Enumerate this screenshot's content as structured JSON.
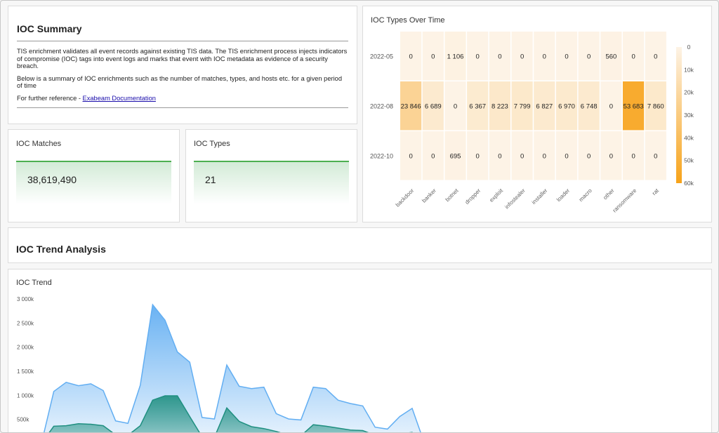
{
  "summary": {
    "title": "IOC Summary",
    "p1": "TIS enrichment validates all event records against existing TIS data. The TIS enrichment process injects indicators of compromise (IOC) tags into event logs and marks that event with IOC metadata as evidence of a security breach.",
    "p2": "Below is a summary of IOC enrichments such as the number of matches, types, and hosts etc. for a given period of time",
    "p3_prefix": "For further reference - ",
    "link_text": "Exabeam Documentation"
  },
  "matches": {
    "title": "IOC Matches",
    "value": "38,619,490"
  },
  "types": {
    "title": "IOC Types",
    "value": "21"
  },
  "trend_section": {
    "title": "IOC Trend Analysis"
  },
  "colors": {
    "heat_low": "#fdf3e6",
    "heat_high": "#f7a319",
    "trend_blue": "#62aef2",
    "trend_teal": "#1f8f80",
    "stat_accent": "#4caf50"
  },
  "chart_data": [
    {
      "type": "heatmap",
      "title": "IOC Types Over Time",
      "x": [
        "backdoor",
        "banker",
        "botnet",
        "dropper",
        "exploit",
        "infostealer",
        "installer",
        "loader",
        "macro",
        "other",
        "ransomware",
        "rat"
      ],
      "y": [
        "2022-05",
        "2022-08",
        "2022-10"
      ],
      "labels": [
        [
          "0",
          "0",
          "1 106",
          "0",
          "0",
          "0",
          "0",
          "0",
          "0",
          "560",
          "0",
          "0"
        ],
        [
          "23 846",
          "6 689",
          "0",
          "6 367",
          "8 223",
          "7 799",
          "6 827",
          "6 970",
          "6 748",
          "0",
          "53 683",
          "7 860"
        ],
        [
          "0",
          "0",
          "695",
          "0",
          "0",
          "0",
          "0",
          "0",
          "0",
          "0",
          "0",
          "0"
        ]
      ],
      "values": [
        [
          0,
          0,
          1106,
          0,
          0,
          0,
          0,
          0,
          0,
          560,
          0,
          0
        ],
        [
          23846,
          6689,
          0,
          6367,
          8223,
          7799,
          6827,
          6970,
          6748,
          0,
          53683,
          7860
        ],
        [
          0,
          0,
          695,
          0,
          0,
          0,
          0,
          0,
          0,
          0,
          0,
          0
        ]
      ],
      "colorbar_ticks": [
        "0",
        "10k",
        "20k",
        "30k",
        "40k",
        "50k",
        "60k"
      ],
      "colorbar_range": [
        0,
        60000
      ]
    },
    {
      "type": "area",
      "title": "IOC Trend",
      "y_ticks": [
        "3 000k",
        "2 500k",
        "2 000k",
        "1 500k",
        "1 000k",
        "500k"
      ],
      "ylim": [
        0,
        3000000
      ],
      "series": [
        {
          "values": [
            0,
            1080000,
            1270000,
            1200000,
            1240000,
            1100000,
            470000,
            420000,
            1210000,
            2880000,
            2560000,
            1900000,
            1690000,
            540000,
            510000,
            1630000,
            1190000,
            1140000,
            1170000,
            620000,
            510000,
            490000,
            1170000,
            1140000,
            900000,
            830000,
            780000,
            340000,
            300000,
            560000,
            730000,
            0
          ]
        },
        {
          "values": [
            0,
            360000,
            370000,
            410000,
            400000,
            370000,
            180000,
            170000,
            370000,
            900000,
            990000,
            990000,
            560000,
            140000,
            130000,
            740000,
            460000,
            350000,
            310000,
            250000,
            170000,
            160000,
            390000,
            360000,
            320000,
            280000,
            270000,
            170000,
            140000,
            200000,
            230000,
            0
          ]
        }
      ]
    }
  ]
}
